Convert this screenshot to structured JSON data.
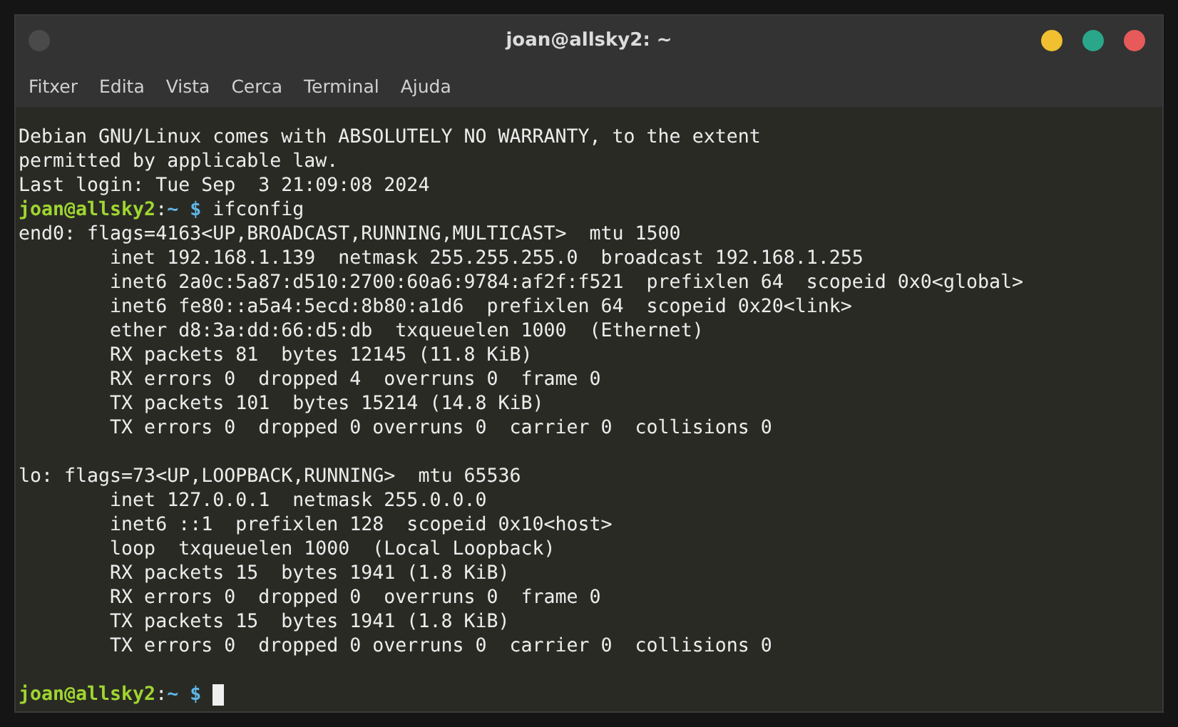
{
  "window": {
    "title": "joan@allsky2: ~"
  },
  "menu": [
    "Fitxer",
    "Edita",
    "Vista",
    "Cerca",
    "Terminal",
    "Ajuda"
  ],
  "terminal": {
    "lines": [
      {
        "kind": "output",
        "text": "Debian GNU/Linux comes with ABSOLUTELY NO WARRANTY, to the extent"
      },
      {
        "kind": "output",
        "text": "permitted by applicable law."
      },
      {
        "kind": "output",
        "text": "Last login: Tue Sep  3 21:09:08 2024"
      },
      {
        "kind": "prompt",
        "user_host": "joan@allsky2",
        "separator": ":",
        "path": "~ $",
        "command": "ifconfig",
        "cursor": false
      },
      {
        "kind": "output",
        "text": "end0: flags=4163<UP,BROADCAST,RUNNING,MULTICAST>  mtu 1500"
      },
      {
        "kind": "output",
        "text": "        inet 192.168.1.139  netmask 255.255.255.0  broadcast 192.168.1.255"
      },
      {
        "kind": "output",
        "text": "        inet6 2a0c:5a87:d510:2700:60a6:9784:af2f:f521  prefixlen 64  scopeid 0x0<global>"
      },
      {
        "kind": "output",
        "text": "        inet6 fe80::a5a4:5ecd:8b80:a1d6  prefixlen 64  scopeid 0x20<link>"
      },
      {
        "kind": "output",
        "text": "        ether d8:3a:dd:66:d5:db  txqueuelen 1000  (Ethernet)"
      },
      {
        "kind": "output",
        "text": "        RX packets 81  bytes 12145 (11.8 KiB)"
      },
      {
        "kind": "output",
        "text": "        RX errors 0  dropped 4  overruns 0  frame 0"
      },
      {
        "kind": "output",
        "text": "        TX packets 101  bytes 15214 (14.8 KiB)"
      },
      {
        "kind": "output",
        "text": "        TX errors 0  dropped 0 overruns 0  carrier 0  collisions 0"
      },
      {
        "kind": "blank"
      },
      {
        "kind": "output",
        "text": "lo: flags=73<UP,LOOPBACK,RUNNING>  mtu 65536"
      },
      {
        "kind": "output",
        "text": "        inet 127.0.0.1  netmask 255.0.0.0"
      },
      {
        "kind": "output",
        "text": "        inet6 ::1  prefixlen 128  scopeid 0x10<host>"
      },
      {
        "kind": "output",
        "text": "        loop  txqueuelen 1000  (Local Loopback)"
      },
      {
        "kind": "output",
        "text": "        RX packets 15  bytes 1941 (1.8 KiB)"
      },
      {
        "kind": "output",
        "text": "        RX errors 0  dropped 0  overruns 0  frame 0"
      },
      {
        "kind": "output",
        "text": "        TX packets 15  bytes 1941 (1.8 KiB)"
      },
      {
        "kind": "output",
        "text": "        TX errors 0  dropped 0 overruns 0  carrier 0  collisions 0"
      },
      {
        "kind": "blank"
      },
      {
        "kind": "prompt",
        "user_host": "joan@allsky2",
        "separator": ":",
        "path": "~ $",
        "cursor": true
      }
    ]
  }
}
